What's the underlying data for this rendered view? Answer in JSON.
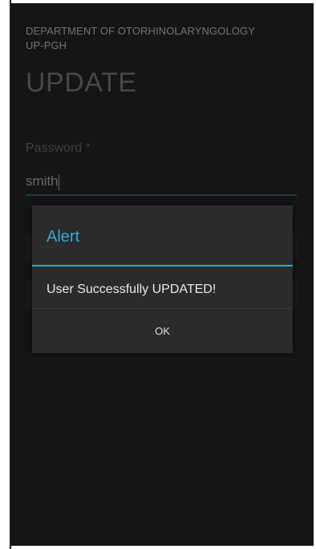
{
  "header": {
    "department_line1": "DEPARTMENT OF OTORHINOLARYNGOLOGY",
    "department_line2": "UP-PGH",
    "title": "UPDATE"
  },
  "form": {
    "password_label": "Password *",
    "password_value": "smith"
  },
  "dialog": {
    "title": "Alert",
    "message": "User Successfully UPDATED!",
    "ok_label": "OK",
    "accent_color": "#35a7d3"
  }
}
